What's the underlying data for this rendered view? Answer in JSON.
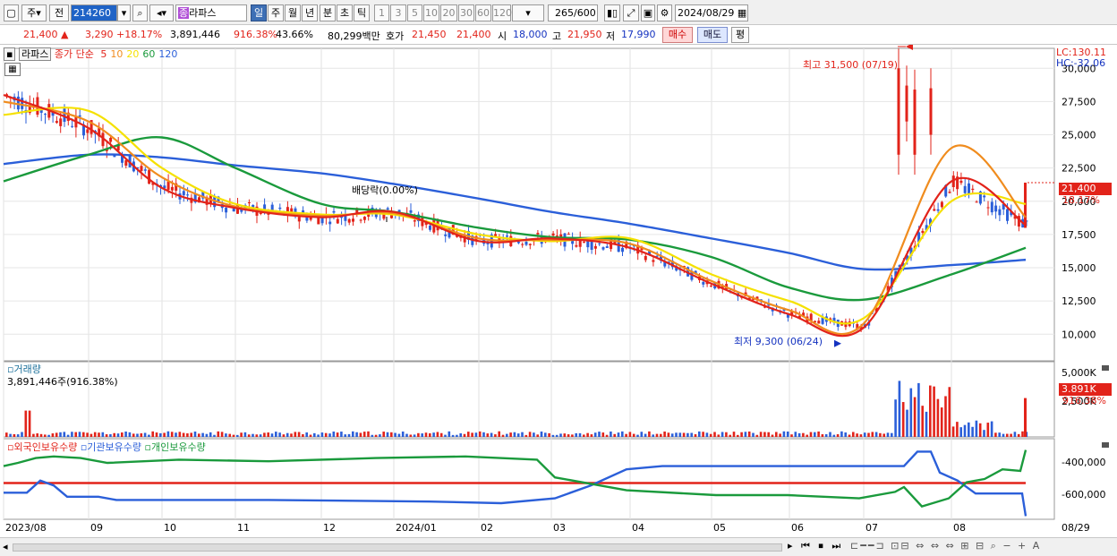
{
  "toolbar": {
    "market": "주",
    "period_mode": "전",
    "code": "214260",
    "name_badge": "종",
    "name": "라파스",
    "periods": [
      "일",
      "주",
      "월",
      "년",
      "분",
      "초",
      "틱"
    ],
    "period_selected": 0,
    "intervals": [
      "1",
      "3",
      "5",
      "10",
      "20",
      "30",
      "60",
      "120"
    ],
    "count_value": "265",
    "count_max": "/600",
    "date": "2024/08/29"
  },
  "quote": {
    "price": "21,400",
    "arrow": "▲",
    "change": "3,290",
    "change_pct": "+18.17%",
    "volume": "3,891,446",
    "volume_ratio": "916.38%",
    "turnover": "43.66%",
    "amount": "80,299백만",
    "ask_label": "호가",
    "ask": "21,450",
    "bid": "21,400",
    "open_label": "시",
    "open": "18,000",
    "high_label": "고",
    "high": "21,950",
    "low_label": "저",
    "low": "17,990",
    "buy_label": "매수",
    "sell_label": "매도",
    "eval_label": "평"
  },
  "price_panel": {
    "badge": "라파스",
    "legend": {
      "prefix": "종가 단순",
      "ma": [
        "5",
        "10",
        "20",
        "60",
        "120"
      ],
      "ma_colors": [
        "#e2231a",
        "#f08c1e",
        "#f5e100",
        "#1a9a3c",
        "#2b5fd9"
      ]
    },
    "lc": "LC:130.11",
    "hc": "HC:-32.06",
    "high_annotation": "최고 31,500 (07/19)",
    "low_annotation": "최저 9,300 (06/24)",
    "dividend_annotation": "배당락(0.00%)",
    "current_price_tag": "21,400",
    "current_pct_tag": "18.17%"
  },
  "volume_panel": {
    "title": "거래량",
    "value": "3,891,446주(916.38%)",
    "tag_value": "3.891K",
    "tag_pct": "916.38%",
    "ticks": [
      "5,000K",
      "2,500K"
    ]
  },
  "holding_panel": {
    "legend": [
      "외국인보유수량",
      "기관보유수량",
      "개인보유수량"
    ],
    "colors": [
      "#e2231a",
      "#2b5fd9",
      "#1a9a3c"
    ],
    "ticks": [
      "-400,000",
      "-600,000"
    ]
  },
  "x_axis": [
    "2023/08",
    "09",
    "10",
    "11",
    "12",
    "2024/01",
    "02",
    "03",
    "04",
    "05",
    "06",
    "07",
    "08"
  ],
  "x_last": "08/29",
  "chart_data": {
    "type": "line",
    "title": "",
    "xlabel": "",
    "ylabel": "",
    "ylim": [
      8000,
      31500
    ],
    "yticks": [
      10000,
      12500,
      15000,
      17500,
      20000,
      22500,
      25000,
      27500,
      30000
    ],
    "ytick_labels": [
      "10,000",
      "12,500",
      "15,000",
      "17,500",
      "20,000",
      "22,500",
      "25,000",
      "27,500",
      "30,000"
    ],
    "x": [
      "2023/08",
      "09",
      "10",
      "11",
      "12",
      "2024/01",
      "02",
      "03",
      "04",
      "05",
      "06",
      "07",
      "08",
      "08/29"
    ],
    "series": [
      {
        "name": "5",
        "values": [
          28000,
          25500,
          21000,
          19500,
          18800,
          19200,
          17000,
          17200,
          16500,
          13800,
          11500,
          10500,
          21500,
          18200
        ]
      },
      {
        "name": "10",
        "values": [
          27500,
          26000,
          21800,
          19600,
          18900,
          19100,
          17200,
          17100,
          16800,
          14000,
          11800,
          10800,
          24000,
          18800
        ]
      },
      {
        "name": "20",
        "values": [
          26500,
          26800,
          22500,
          19800,
          19000,
          19000,
          17500,
          17000,
          17200,
          14500,
          12500,
          11200,
          20000,
          19800
        ]
      },
      {
        "name": "60",
        "values": [
          21500,
          23500,
          24800,
          22500,
          19800,
          19200,
          18000,
          17300,
          17100,
          15800,
          13500,
          12600,
          14500,
          16500
        ]
      },
      {
        "name": "120",
        "values": [
          22800,
          23500,
          23300,
          22700,
          22100,
          21300,
          20200,
          19200,
          18300,
          17200,
          16100,
          14900,
          15200,
          15600
        ]
      }
    ],
    "extremes": {
      "high": 31500,
      "high_date": "07/19",
      "low": 9300,
      "low_date": "06/24"
    },
    "last_close": 21400
  }
}
